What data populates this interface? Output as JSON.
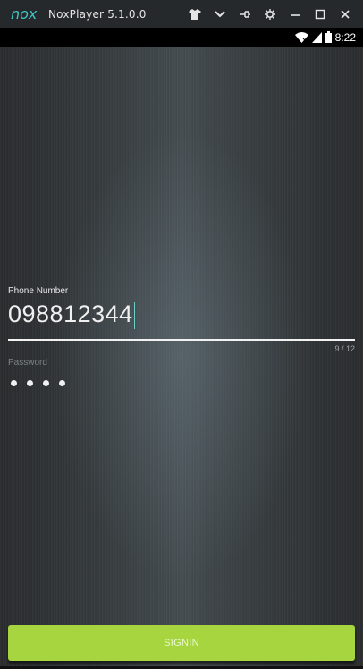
{
  "window": {
    "logo_text": "nox",
    "title": "NoxPlayer 5.1.0.0",
    "controls": [
      {
        "name": "shirt-icon"
      },
      {
        "name": "chevron-down-icon"
      },
      {
        "name": "pin-icon"
      },
      {
        "name": "gear-icon"
      },
      {
        "name": "minimize-icon"
      },
      {
        "name": "maximize-icon"
      },
      {
        "name": "close-icon"
      }
    ]
  },
  "statusbar": {
    "time": "8:22",
    "icons": [
      "wifi-icon",
      "signal-icon",
      "battery-icon"
    ]
  },
  "form": {
    "phone": {
      "label": "Phone Number",
      "value": "098812344",
      "counter": "9 / 12"
    },
    "password": {
      "label": "Password",
      "masked_length": 4
    },
    "signin_label": "SIGNIN"
  },
  "colors": {
    "accent": "#a6d53f",
    "titlebar": "#26292c",
    "logo": "#3ec6c6"
  }
}
